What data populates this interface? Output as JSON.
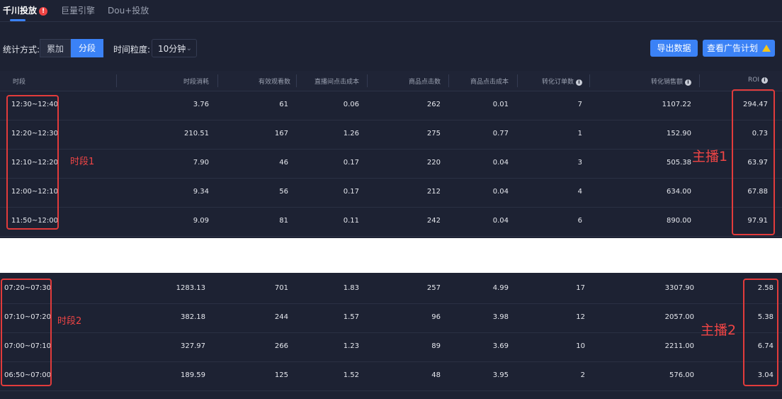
{
  "tabs": [
    {
      "label": "千川投放"
    },
    {
      "label": "巨量引擎"
    },
    {
      "label": "Dou+投放"
    }
  ],
  "filters": {
    "stat_label": "统计方式:",
    "stat_options": [
      "累加",
      "分段"
    ],
    "granularity_label": "时间粒度:",
    "granularity_value": "10分钟"
  },
  "actions": {
    "export_label": "导出数据",
    "view_plan_label": "查看广告计划"
  },
  "columns": [
    "时段",
    "时段消耗",
    "有效观看数",
    "直播间点击成本",
    "商品点击数",
    "商品点击成本",
    "转化订单数",
    "转化销售额",
    "ROI"
  ],
  "table1": {
    "rows": [
      [
        "12:30~12:40",
        "3.76",
        "61",
        "0.06",
        "262",
        "0.01",
        "7",
        "1107.22",
        "294.47"
      ],
      [
        "12:20~12:30",
        "210.51",
        "167",
        "1.26",
        "275",
        "0.77",
        "1",
        "152.90",
        "0.73"
      ],
      [
        "12:10~12:20",
        "7.90",
        "46",
        "0.17",
        "220",
        "0.04",
        "3",
        "505.38",
        "63.97"
      ],
      [
        "12:00~12:10",
        "9.34",
        "56",
        "0.17",
        "212",
        "0.04",
        "4",
        "634.00",
        "67.88"
      ],
      [
        "11:50~12:00",
        "9.09",
        "81",
        "0.11",
        "242",
        "0.04",
        "6",
        "890.00",
        "97.91"
      ]
    ]
  },
  "table2": {
    "rows": [
      [
        "07:20~07:30",
        "1283.13",
        "701",
        "1.83",
        "257",
        "4.99",
        "17",
        "3307.90",
        "2.58"
      ],
      [
        "07:10~07:20",
        "382.18",
        "244",
        "1.57",
        "96",
        "3.98",
        "12",
        "2057.00",
        "5.38"
      ],
      [
        "07:00~07:10",
        "327.97",
        "266",
        "1.23",
        "89",
        "3.69",
        "10",
        "2211.00",
        "6.74"
      ],
      [
        "06:50~07:00",
        "189.59",
        "125",
        "1.52",
        "48",
        "3.95",
        "2",
        "576.00",
        "3.04"
      ]
    ]
  },
  "annotations": {
    "period1": "时段1",
    "period2": "时段2",
    "host1": "主播1",
    "host2": "主播2"
  },
  "colors": {
    "background": "#1d2233",
    "accent": "#3b82f6",
    "annotation_red": "#e23b3b",
    "warning": "#f5c518"
  },
  "icons": [
    "alert-icon",
    "chevron-down-icon",
    "warning-icon",
    "info-icon"
  ]
}
